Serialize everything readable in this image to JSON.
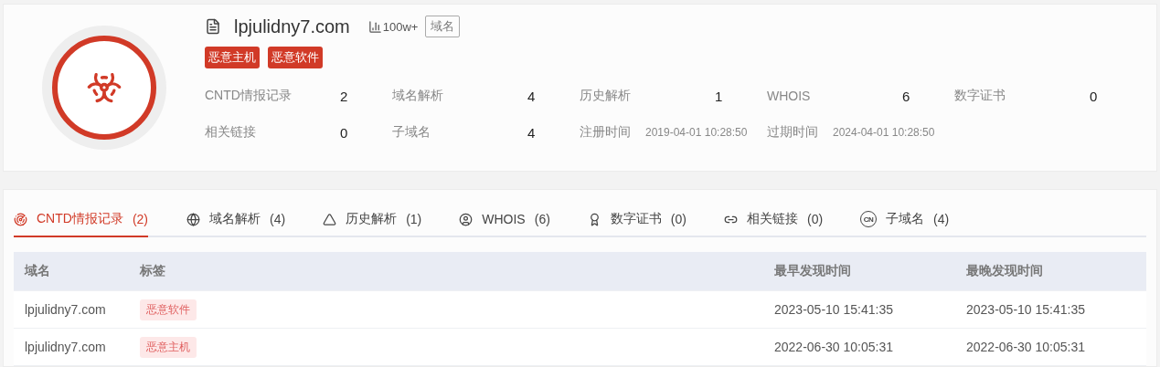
{
  "header": {
    "domain": "lpjulidny7.com",
    "rank": "100w+",
    "type_badge": "域名",
    "tags": [
      "恶意主机",
      "恶意软件"
    ]
  },
  "stats": [
    {
      "label": "CNTD情报记录",
      "value": "2",
      "kind": "count"
    },
    {
      "label": "域名解析",
      "value": "4",
      "kind": "count"
    },
    {
      "label": "历史解析",
      "value": "1",
      "kind": "count"
    },
    {
      "label": "WHOIS",
      "value": "6",
      "kind": "count"
    },
    {
      "label": "数字证书",
      "value": "0",
      "kind": "count"
    },
    {
      "label": "相关链接",
      "value": "0",
      "kind": "count"
    },
    {
      "label": "子域名",
      "value": "4",
      "kind": "count"
    },
    {
      "label": "注册时间",
      "value": "2019-04-01 10:28:50",
      "kind": "date"
    },
    {
      "label": "过期时间",
      "value": "2024-04-01 10:28:50",
      "kind": "date"
    }
  ],
  "tabs": [
    {
      "label": "CNTD情报记录",
      "count": "(2)",
      "selected": true
    },
    {
      "label": "域名解析",
      "count": "(4)",
      "selected": false
    },
    {
      "label": "历史解析",
      "count": "(1)",
      "selected": false
    },
    {
      "label": "WHOIS",
      "count": "(6)",
      "selected": false
    },
    {
      "label": "数字证书",
      "count": "(0)",
      "selected": false
    },
    {
      "label": "相关链接",
      "count": "(0)",
      "selected": false
    },
    {
      "label": "子域名",
      "count": "(4)",
      "selected": false,
      "icon_text": "CN"
    }
  ],
  "table": {
    "columns": [
      "域名",
      "标签",
      "最早发现时间",
      "最晚发现时间"
    ],
    "rows": [
      {
        "domain": "lpjulidny7.com",
        "tag": "恶意软件",
        "first_seen": "2023-05-10 15:41:35",
        "last_seen": "2023-05-10 15:41:35"
      },
      {
        "domain": "lpjulidny7.com",
        "tag": "恶意主机",
        "first_seen": "2022-06-30 10:05:31",
        "last_seen": "2022-06-30 10:05:31"
      }
    ]
  }
}
